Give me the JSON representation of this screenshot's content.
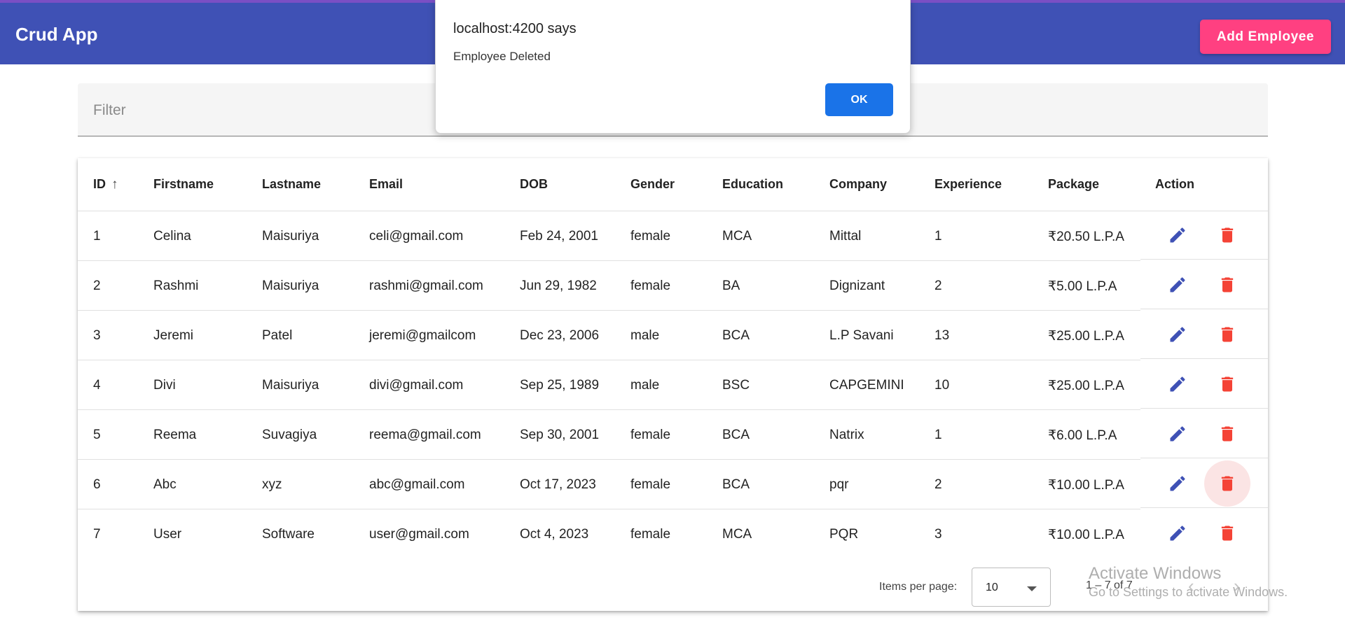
{
  "toolbar": {
    "title": "Crud App",
    "add_button_label": "Add Employee",
    "background_color": "#3f51b5",
    "add_button_color": "#ff4081"
  },
  "filter": {
    "label": "Filter",
    "value": ""
  },
  "table": {
    "columns": [
      "ID",
      "Firstname",
      "Lastname",
      "Email",
      "DOB",
      "Gender",
      "Education",
      "Company",
      "Experience",
      "Package",
      "Action"
    ],
    "sort": {
      "column": "ID",
      "direction": "ascending",
      "icon": "arrow-up-icon"
    },
    "rows": [
      {
        "id": "1",
        "firstname": "Celina",
        "lastname": "Maisuriya",
        "email": "celi@gmail.com",
        "dob": "Feb 24, 2001",
        "gender": "female",
        "education": "MCA",
        "company": "Mittal",
        "experience": "1",
        "package": "₹20.50 L.P.A"
      },
      {
        "id": "2",
        "firstname": "Rashmi",
        "lastname": "Maisuriya",
        "email": "rashmi@gmail.com",
        "dob": "Jun 29, 1982",
        "gender": "female",
        "education": "BA",
        "company": "Dignizant",
        "experience": "2",
        "package": "₹5.00 L.P.A"
      },
      {
        "id": "3",
        "firstname": "Jeremi",
        "lastname": "Patel",
        "email": "jeremi@gmailcom",
        "dob": "Dec 23, 2006",
        "gender": "male",
        "education": "BCA",
        "company": "L.P Savani",
        "experience": "13",
        "package": "₹25.00 L.P.A"
      },
      {
        "id": "4",
        "firstname": "Divi",
        "lastname": "Maisuriya",
        "email": "divi@gmail.com",
        "dob": "Sep 25, 1989",
        "gender": "male",
        "education": "BSC",
        "company": "CAPGEMINI",
        "experience": "10",
        "package": "₹25.00 L.P.A"
      },
      {
        "id": "5",
        "firstname": "Reema",
        "lastname": "Suvagiya",
        "email": "reema@gmail.com",
        "dob": "Sep 30, 2001",
        "gender": "female",
        "education": "BCA",
        "company": "Natrix",
        "experience": "1",
        "package": "₹6.00 L.P.A"
      },
      {
        "id": "6",
        "firstname": "Abc",
        "lastname": "xyz",
        "email": "abc@gmail.com",
        "dob": "Oct 17, 2023",
        "gender": "female",
        "education": "BCA",
        "company": "pqr",
        "experience": "2",
        "package": "₹10.00 L.P.A"
      },
      {
        "id": "7",
        "firstname": "User",
        "lastname": "Software",
        "email": "user@gmail.com",
        "dob": "Oct 4, 2023",
        "gender": "female",
        "education": "MCA",
        "company": "PQR",
        "experience": "3",
        "package": "₹10.00 L.P.A"
      }
    ],
    "action_icons": {
      "edit": "pencil-icon",
      "delete": "trash-icon"
    },
    "edit_color": "#3f51b5",
    "delete_color": "#f44336"
  },
  "paginator": {
    "items_per_page_label": "Items per page:",
    "page_size": "10",
    "range_label": "1 – 7 of 7",
    "prev_icon": "chevron-left-icon",
    "next_icon": "chevron-right-icon"
  },
  "dialog": {
    "title": "localhost:4200 says",
    "message": "Employee Deleted",
    "ok_label": "OK",
    "ok_color": "#1a73e8"
  },
  "watermark": {
    "title": "Activate Windows",
    "subtitle": "Go to Settings to activate Windows."
  }
}
